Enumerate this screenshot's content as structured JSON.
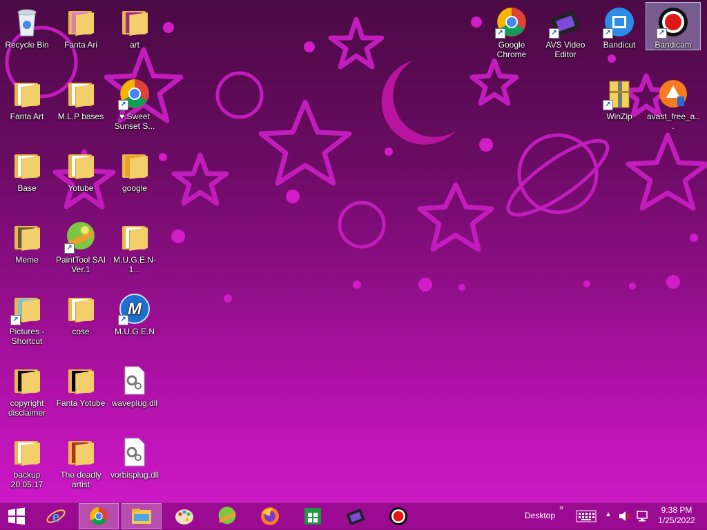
{
  "desktop": {
    "icons": [
      {
        "label": "Recycle Bin",
        "icon": "recycle-bin-icon"
      },
      {
        "label": "Fanta Ari",
        "icon": "folder-icon"
      },
      {
        "label": "art",
        "icon": "folder-icon"
      },
      {
        "label": "Fanta Art",
        "icon": "folder-icon"
      },
      {
        "label": "M.L.P bases",
        "icon": "folder-icon"
      },
      {
        "label": "♥ Sweet Sunset S...",
        "icon": "chrome-icon"
      },
      {
        "label": "Base",
        "icon": "folder-icon"
      },
      {
        "label": "Yotube",
        "icon": "folder-icon"
      },
      {
        "label": "google",
        "icon": "folder-icon"
      },
      {
        "label": "Meme",
        "icon": "folder-icon"
      },
      {
        "label": "PaintTool SAI Ver.1",
        "icon": "painttool-sai-icon"
      },
      {
        "label": "M.U.G.E.N-1...",
        "icon": "folder-icon"
      },
      {
        "label": "Pictures - Shortcut",
        "icon": "pictures-icon"
      },
      {
        "label": "cose",
        "icon": "folder-icon"
      },
      {
        "label": "M.U.G.E.N",
        "icon": "mugen-icon"
      },
      {
        "label": "copyright disclaimer",
        "icon": "folder-icon"
      },
      {
        "label": "Fanta Yotube",
        "icon": "folder-icon"
      },
      {
        "label": "waveplug.dll",
        "icon": "dll-file-icon"
      },
      {
        "label": "backup 20.05.17",
        "icon": "folder-icon"
      },
      {
        "label": "The deadly artist",
        "icon": "folder-icon"
      },
      {
        "label": "vorbisplug.dll",
        "icon": "dll-file-icon"
      },
      {
        "label": "Google Chrome",
        "icon": "chrome-icon"
      },
      {
        "label": "AVS Video Editor",
        "icon": "avs-video-editor-icon"
      },
      {
        "label": "Bandicut",
        "icon": "bandicut-icon"
      },
      {
        "label": "Bandicam",
        "icon": "bandicam-icon"
      },
      {
        "label": "WinZip",
        "icon": "winzip-icon"
      },
      {
        "label": "avast_free_a...",
        "icon": "avast-icon"
      }
    ]
  },
  "taskbar": {
    "start_icon": "windows-start-icon",
    "apps": [
      {
        "name": "internet-explorer",
        "icon": "internet-explorer-icon"
      },
      {
        "name": "google-chrome",
        "icon": "chrome-icon"
      },
      {
        "name": "file-explorer",
        "icon": "file-explorer-icon"
      },
      {
        "name": "paint",
        "icon": "paint-palette-icon"
      },
      {
        "name": "painttool-sai",
        "icon": "painttool-sai-icon"
      },
      {
        "name": "firefox",
        "icon": "firefox-icon"
      },
      {
        "name": "store",
        "icon": "windows-store-icon"
      },
      {
        "name": "avs-video-editor",
        "icon": "avs-video-editor-icon"
      },
      {
        "name": "bandicam",
        "icon": "bandicam-icon"
      }
    ],
    "desktop_label": "Desktop",
    "chevron": "»",
    "time": "9:38 PM",
    "date": "1/25/2022"
  }
}
